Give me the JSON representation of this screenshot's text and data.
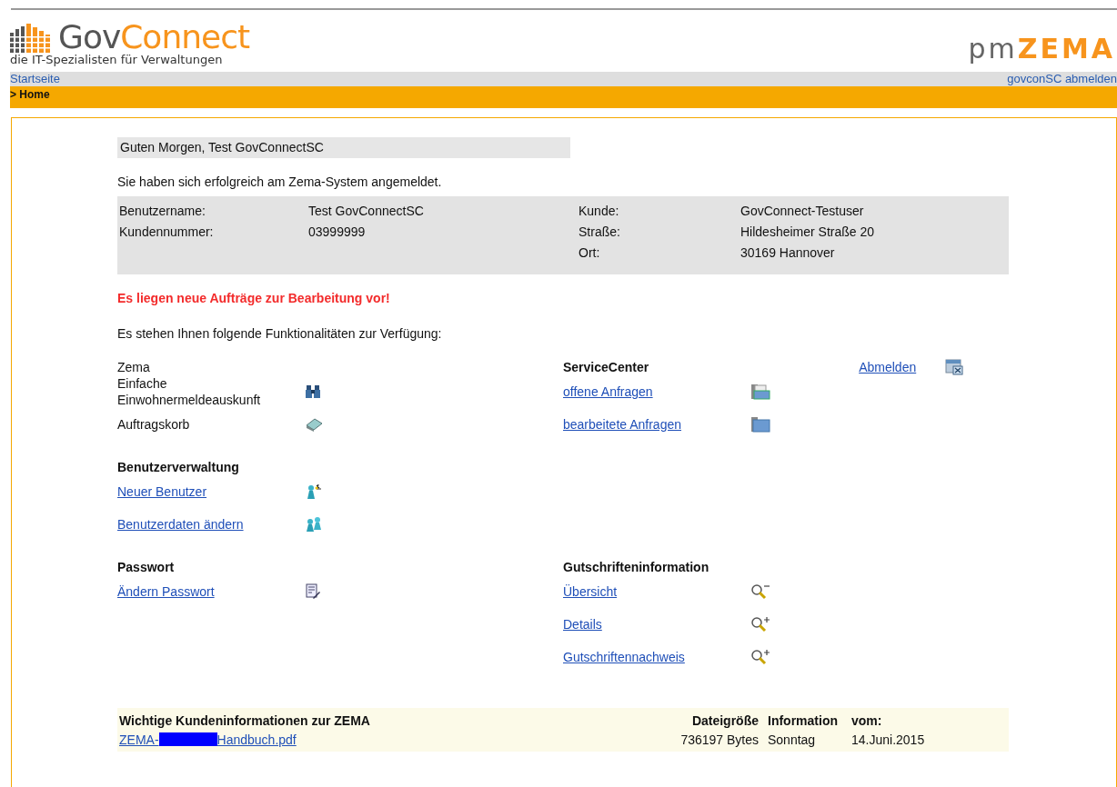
{
  "header": {
    "logo_gov": "Gov",
    "logo_connect": "Connect",
    "tagline": "die IT-Spezialisten für Verwaltungen",
    "product_pm": "pm",
    "product_zema": "ZEMA"
  },
  "nav": {
    "home_link": "Startseite",
    "logout_link": "govconSC abmelden",
    "breadcrumb": "> Home"
  },
  "greeting": "Guten Morgen, Test GovConnectSC",
  "login_message": "Sie haben sich erfolgreich am Zema-System angemeldet.",
  "user_info": [
    {
      "label": "Benutzername:",
      "value": "Test GovConnectSC",
      "label_2": "Kunde:",
      "value_2": "GovConnect-Testuser"
    },
    {
      "label": "Kundennummer:",
      "value": "03999999",
      "label_2": "Straße:",
      "value_2": "Hildesheimer Straße 20"
    },
    {
      "label_2": "Ort:",
      "value_2": "30169 Hannover"
    }
  ],
  "alert": "Es liegen neue Aufträge zur Bearbeitung vor!",
  "intro": "Es stehen Ihnen folgende Funktionalitäten zur Verfügung:",
  "logout": "Abmelden",
  "section_rows": [
    [
      {
        "heading": "Zema",
        "bold": false,
        "items": [
          {
            "kind": "text",
            "label": "Einfache Einwohnermeldeauskunft"
          },
          {
            "kind": "text",
            "label": "Auftragskorb"
          }
        ]
      },
      {
        "heading": "ServiceCenter",
        "bold": true,
        "items": [
          {
            "kind": "link",
            "label": "offene Anfragen"
          },
          {
            "kind": "link",
            "label": "bearbeitete Anfragen"
          }
        ]
      }
    ],
    [
      {
        "heading": "Benutzerverwaltung",
        "bold": true,
        "items": [
          {
            "kind": "link",
            "label": "Neuer Benutzer"
          },
          {
            "kind": "link",
            "label": "Benutzerdaten ändern"
          }
        ]
      }
    ],
    [
      {
        "heading": "Passwort",
        "bold": true,
        "items": [
          {
            "kind": "link",
            "label": "Ändern Passwort"
          }
        ]
      },
      {
        "heading": "Gutschrifteninformation",
        "bold": true,
        "items": [
          {
            "kind": "link",
            "label": "Übersicht"
          },
          {
            "kind": "link",
            "label": "Details"
          },
          {
            "kind": "link",
            "label": "Gutschriftennachweis"
          }
        ]
      }
    ]
  ],
  "documents": {
    "columns": [
      "Wichtige Kundeninformationen zur ZEMA",
      "Dateigröße",
      "Information",
      "vom:"
    ],
    "rows": [
      {
        "name_start": "ZEMA-",
        "name_end": "Handbuch.pdf",
        "size": "736197 Bytes",
        "day": "Sonntag",
        "date": "14.Juni.2015"
      }
    ]
  }
}
